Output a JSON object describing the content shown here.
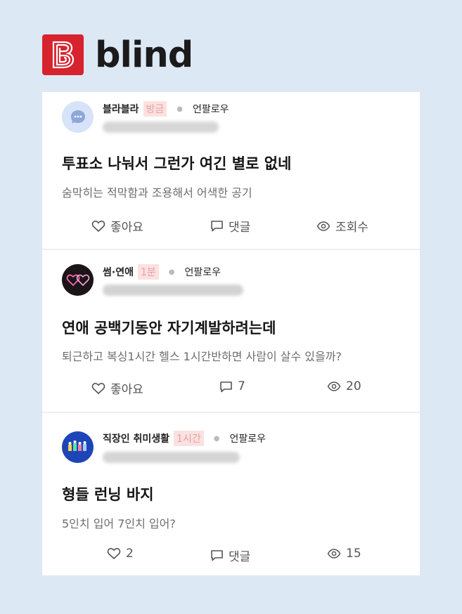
{
  "app": {
    "name": "blind",
    "logo_letter": "B",
    "brand_color": "#d7232d"
  },
  "posts": [
    {
      "channel": "블라블라",
      "time": "방금",
      "follow": "언팔로우",
      "title": "투표소 나눠서 그런가 여긴 별로 없네",
      "body": "숨막히는 적막함과 조용해서 어색한 공기",
      "like": "좋아요",
      "comment": "댓글",
      "views": "조회수",
      "avatar_icon": "chat-bubble-icon"
    },
    {
      "channel": "썸·연애",
      "time": "1분",
      "follow": "언팔로우",
      "title": "연애 공백기동안 자기계발하려는데",
      "body": "퇴근하고 복싱1시간 헬스 1시간반하면 사람이 살수 있을까?",
      "like": "좋아요",
      "comment": "7",
      "views": "20",
      "avatar_icon": "neon-hearts-icon"
    },
    {
      "channel": "직장인 취미생활",
      "time": "1시간",
      "follow": "언팔로우",
      "title": "형들 런닝 바지",
      "body": "5인치 입어 7인치 입어?",
      "like": "2",
      "comment": "댓글",
      "views": "15",
      "avatar_icon": "hobby-figures-icon"
    }
  ]
}
